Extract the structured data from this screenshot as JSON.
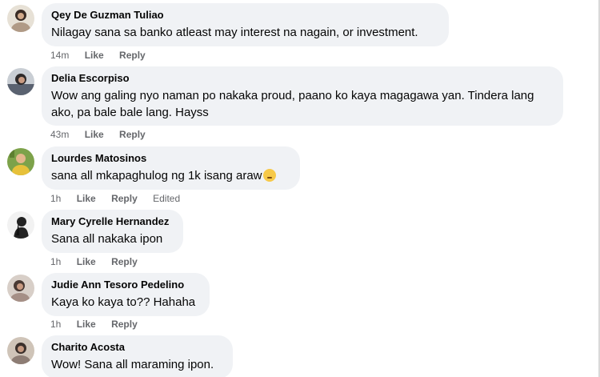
{
  "comments": [
    {
      "name": "Qey De Guzman Tuliao",
      "text": "Nilagay sana sa banko atleast may interest na nagain, or investment.",
      "time": "14m",
      "like": "Like",
      "reply": "Reply"
    },
    {
      "name": "Delia Escorpiso",
      "text": "Wow ang galing nyo naman po nakaka proud, paano ko kaya magagawa yan. Tindera lang ako, pa bale bale lang. Hayss",
      "time": "43m",
      "like": "Like",
      "reply": "Reply"
    },
    {
      "name": "Lourdes Matosinos",
      "text": "sana all mkapaghulog ng 1k isang araw",
      "emoji": "worried-face-emoji",
      "time": "1h",
      "like": "Like",
      "reply": "Reply",
      "edited": "Edited"
    },
    {
      "name": "Mary Cyrelle Hernandez",
      "text": "Sana all nakaka ipon",
      "time": "1h",
      "like": "Like",
      "reply": "Reply"
    },
    {
      "name": "Judie Ann Tesoro Pedelino",
      "text": "Kaya ko kaya to?? Hahaha",
      "time": "1h",
      "like": "Like",
      "reply": "Reply"
    },
    {
      "name": "Charito Acosta",
      "text": "Wow! Sana all maraming ipon."
    }
  ]
}
